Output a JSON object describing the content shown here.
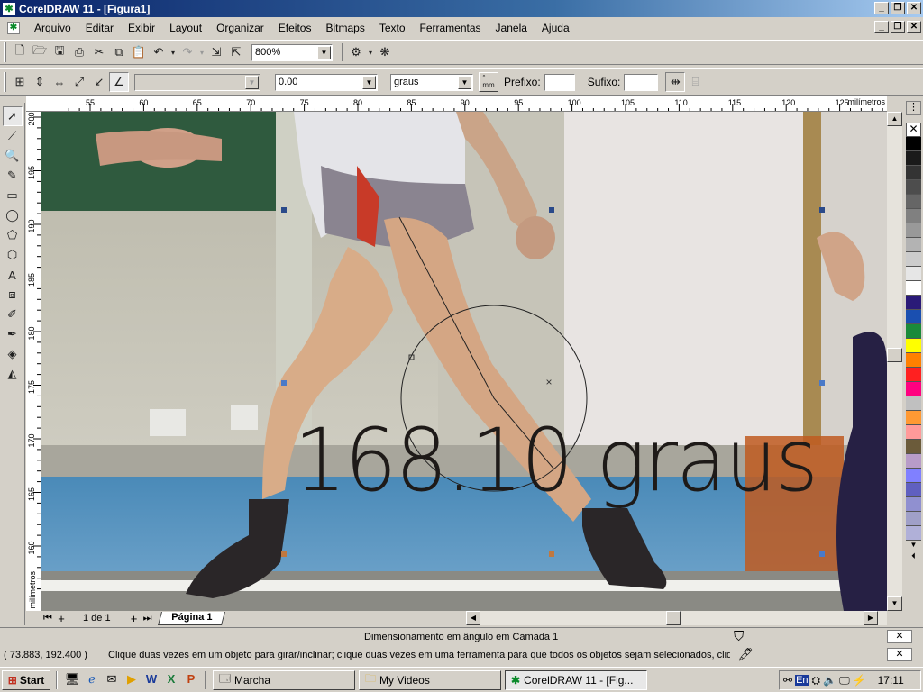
{
  "window": {
    "title": "CorelDRAW 11 - [Figura1]"
  },
  "menu": [
    "Arquivo",
    "Editar",
    "Exibir",
    "Layout",
    "Organizar",
    "Efeitos",
    "Bitmaps",
    "Texto",
    "Ferramentas",
    "Janela",
    "Ajuda"
  ],
  "standard_toolbar": {
    "zoom": "800%"
  },
  "property_bar": {
    "angle_value": "0.00",
    "units": "graus",
    "unit_toggle": "°\nmm",
    "prefix_label": "Prefixo:",
    "suffix_label": "Sufixo:",
    "prefix_value": "",
    "suffix_value": ""
  },
  "ruler": {
    "h_unit": "milímetros",
    "h_ticks": [
      "55",
      "60",
      "65",
      "70",
      "75",
      "80",
      "85",
      "90",
      "95",
      "100",
      "105",
      "110",
      "115",
      "120",
      "125"
    ],
    "v_unit": "milímetros",
    "v_ticks": [
      "200",
      "195",
      "190",
      "185",
      "180",
      "175",
      "170",
      "165",
      "160"
    ]
  },
  "canvas": {
    "measurement_text": "168.10 graus"
  },
  "page_nav": {
    "page_count": "1 de 1",
    "page_tab": "Página 1"
  },
  "status": {
    "object_info": "Dimensionamento em ângulo em Camada 1",
    "coordinates": "( 73.883, 192.400 )",
    "hint": "Clique duas vezes em um objeto para girar/inclinar; clique duas vezes em uma ferramenta para que todos os objetos sejam selecionados, clique c..."
  },
  "palette_colors": [
    "#000000",
    "#1a1a1a",
    "#333333",
    "#4d4d4d",
    "#666666",
    "#808080",
    "#999999",
    "#b3b3b3",
    "#cccccc",
    "#e6e6e6",
    "#ffffff",
    "#2a1a78",
    "#1a4fb0",
    "#1a8a3a",
    "#ffff00",
    "#ff8000",
    "#ff2020",
    "#ff0080",
    "#c0c0c0",
    "#ff9933",
    "#ff9a9a",
    "#6b5b3a",
    "#b89cc8",
    "#8080ff",
    "#6060c0",
    "#9090d0",
    "#a0a0c8",
    "#b0b0d8"
  ],
  "taskbar": {
    "start": "Start",
    "tasks": [
      "Marcha",
      "My Videos",
      "CorelDRAW 11 - [Fig..."
    ],
    "lang": "En",
    "clock": "17:11"
  }
}
